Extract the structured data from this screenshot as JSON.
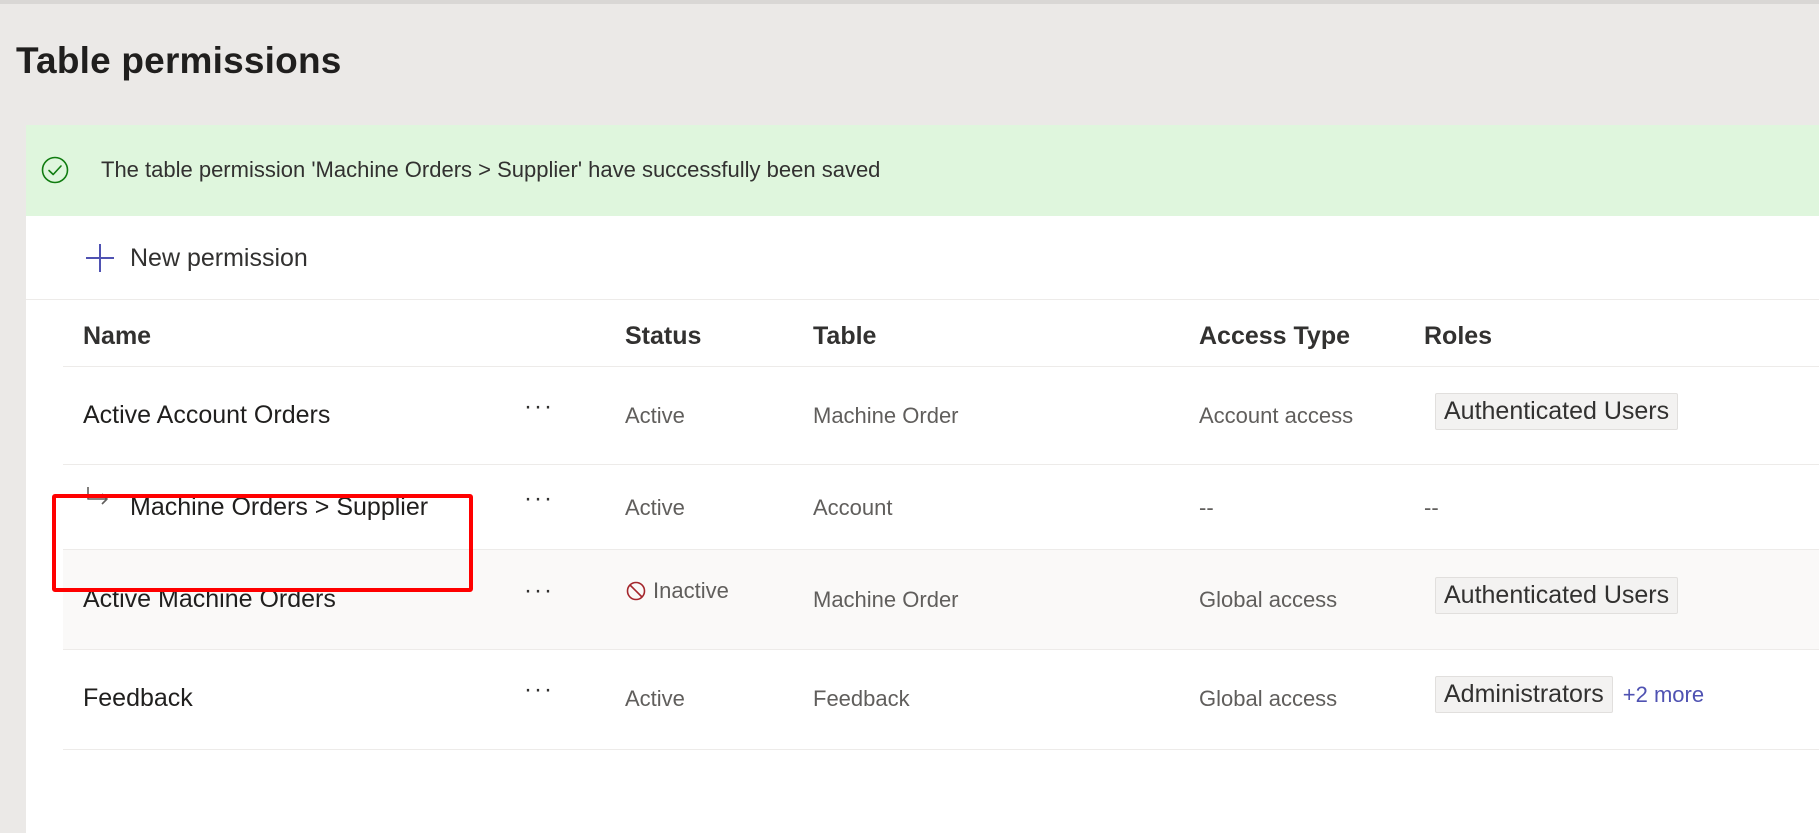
{
  "page": {
    "title": "Table permissions"
  },
  "banner": {
    "icon": "check-circle-icon",
    "text": "The table permission 'Machine Orders > Supplier' have successfully been saved",
    "bg_color": "#dff6dd"
  },
  "toolbar": {
    "new_label": "New permission",
    "new_icon": "plus-icon"
  },
  "columns": {
    "name": "Name",
    "status": "Status",
    "table": "Table",
    "access_type": "Access Type",
    "roles": "Roles"
  },
  "rows": [
    {
      "name": "Active Account Orders",
      "more": "···",
      "status": "Active",
      "table": "Machine Order",
      "access_type": "Account access",
      "role": "Authenticated Users",
      "extra": ""
    },
    {
      "name": "Machine Orders > Supplier",
      "more": "···",
      "status": "Active",
      "table": "Account",
      "access_type": "--",
      "role": "--",
      "extra": ""
    },
    {
      "name": "Active Machine Orders",
      "more": "···",
      "status": "Inactive",
      "table": "Machine Order",
      "access_type": "Global access",
      "role": "Authenticated Users",
      "extra": ""
    },
    {
      "name": "Feedback",
      "more": "···",
      "status": "Active",
      "table": "Feedback",
      "access_type": "Global access",
      "role": "Administrators",
      "extra": "+2 more"
    }
  ],
  "colors": {
    "accent": "#4f52b2",
    "success_bg": "#dff6dd",
    "highlight": "#ff0000",
    "inactive_icon": "#a4262c"
  }
}
